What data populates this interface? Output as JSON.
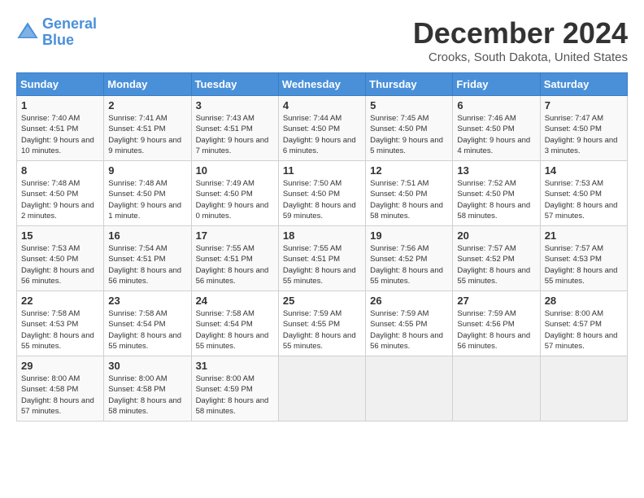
{
  "logo": {
    "line1": "General",
    "line2": "Blue"
  },
  "title": "December 2024",
  "location": "Crooks, South Dakota, United States",
  "days_of_week": [
    "Sunday",
    "Monday",
    "Tuesday",
    "Wednesday",
    "Thursday",
    "Friday",
    "Saturday"
  ],
  "weeks": [
    [
      {
        "day": "1",
        "sunrise": "7:40 AM",
        "sunset": "4:51 PM",
        "daylight": "9 hours and 10 minutes."
      },
      {
        "day": "2",
        "sunrise": "7:41 AM",
        "sunset": "4:51 PM",
        "daylight": "9 hours and 9 minutes."
      },
      {
        "day": "3",
        "sunrise": "7:43 AM",
        "sunset": "4:51 PM",
        "daylight": "9 hours and 7 minutes."
      },
      {
        "day": "4",
        "sunrise": "7:44 AM",
        "sunset": "4:50 PM",
        "daylight": "9 hours and 6 minutes."
      },
      {
        "day": "5",
        "sunrise": "7:45 AM",
        "sunset": "4:50 PM",
        "daylight": "9 hours and 5 minutes."
      },
      {
        "day": "6",
        "sunrise": "7:46 AM",
        "sunset": "4:50 PM",
        "daylight": "9 hours and 4 minutes."
      },
      {
        "day": "7",
        "sunrise": "7:47 AM",
        "sunset": "4:50 PM",
        "daylight": "9 hours and 3 minutes."
      }
    ],
    [
      {
        "day": "8",
        "sunrise": "7:48 AM",
        "sunset": "4:50 PM",
        "daylight": "9 hours and 2 minutes."
      },
      {
        "day": "9",
        "sunrise": "7:48 AM",
        "sunset": "4:50 PM",
        "daylight": "9 hours and 1 minute."
      },
      {
        "day": "10",
        "sunrise": "7:49 AM",
        "sunset": "4:50 PM",
        "daylight": "9 hours and 0 minutes."
      },
      {
        "day": "11",
        "sunrise": "7:50 AM",
        "sunset": "4:50 PM",
        "daylight": "8 hours and 59 minutes."
      },
      {
        "day": "12",
        "sunrise": "7:51 AM",
        "sunset": "4:50 PM",
        "daylight": "8 hours and 58 minutes."
      },
      {
        "day": "13",
        "sunrise": "7:52 AM",
        "sunset": "4:50 PM",
        "daylight": "8 hours and 58 minutes."
      },
      {
        "day": "14",
        "sunrise": "7:53 AM",
        "sunset": "4:50 PM",
        "daylight": "8 hours and 57 minutes."
      }
    ],
    [
      {
        "day": "15",
        "sunrise": "7:53 AM",
        "sunset": "4:50 PM",
        "daylight": "8 hours and 56 minutes."
      },
      {
        "day": "16",
        "sunrise": "7:54 AM",
        "sunset": "4:51 PM",
        "daylight": "8 hours and 56 minutes."
      },
      {
        "day": "17",
        "sunrise": "7:55 AM",
        "sunset": "4:51 PM",
        "daylight": "8 hours and 56 minutes."
      },
      {
        "day": "18",
        "sunrise": "7:55 AM",
        "sunset": "4:51 PM",
        "daylight": "8 hours and 55 minutes."
      },
      {
        "day": "19",
        "sunrise": "7:56 AM",
        "sunset": "4:52 PM",
        "daylight": "8 hours and 55 minutes."
      },
      {
        "day": "20",
        "sunrise": "7:57 AM",
        "sunset": "4:52 PM",
        "daylight": "8 hours and 55 minutes."
      },
      {
        "day": "21",
        "sunrise": "7:57 AM",
        "sunset": "4:53 PM",
        "daylight": "8 hours and 55 minutes."
      }
    ],
    [
      {
        "day": "22",
        "sunrise": "7:58 AM",
        "sunset": "4:53 PM",
        "daylight": "8 hours and 55 minutes."
      },
      {
        "day": "23",
        "sunrise": "7:58 AM",
        "sunset": "4:54 PM",
        "daylight": "8 hours and 55 minutes."
      },
      {
        "day": "24",
        "sunrise": "7:58 AM",
        "sunset": "4:54 PM",
        "daylight": "8 hours and 55 minutes."
      },
      {
        "day": "25",
        "sunrise": "7:59 AM",
        "sunset": "4:55 PM",
        "daylight": "8 hours and 55 minutes."
      },
      {
        "day": "26",
        "sunrise": "7:59 AM",
        "sunset": "4:55 PM",
        "daylight": "8 hours and 56 minutes."
      },
      {
        "day": "27",
        "sunrise": "7:59 AM",
        "sunset": "4:56 PM",
        "daylight": "8 hours and 56 minutes."
      },
      {
        "day": "28",
        "sunrise": "8:00 AM",
        "sunset": "4:57 PM",
        "daylight": "8 hours and 57 minutes."
      }
    ],
    [
      {
        "day": "29",
        "sunrise": "8:00 AM",
        "sunset": "4:58 PM",
        "daylight": "8 hours and 57 minutes."
      },
      {
        "day": "30",
        "sunrise": "8:00 AM",
        "sunset": "4:58 PM",
        "daylight": "8 hours and 58 minutes."
      },
      {
        "day": "31",
        "sunrise": "8:00 AM",
        "sunset": "4:59 PM",
        "daylight": "8 hours and 58 minutes."
      },
      null,
      null,
      null,
      null
    ]
  ]
}
